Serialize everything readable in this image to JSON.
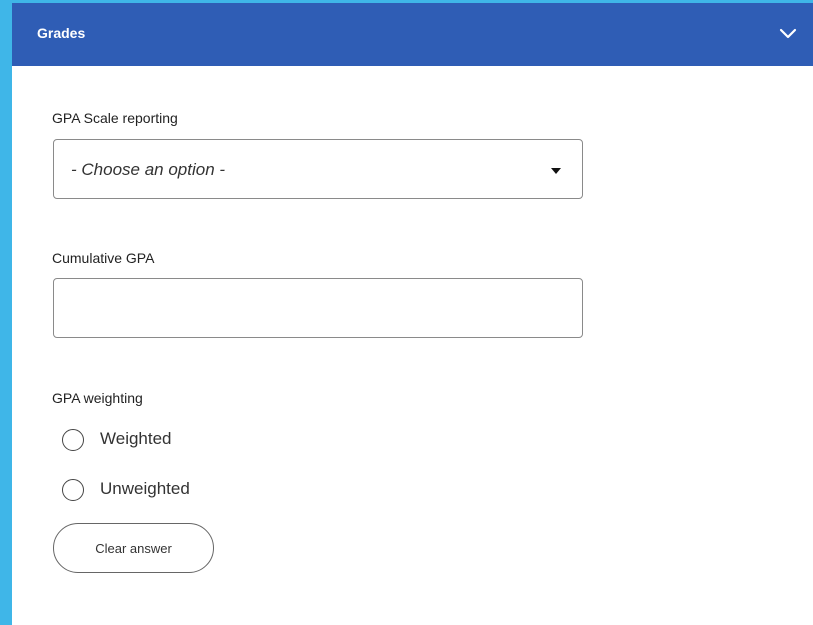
{
  "section": {
    "title": "Grades",
    "collapse_icon": "chevron-down-icon"
  },
  "gpa_scale": {
    "label": "GPA Scale reporting",
    "selected": "- Choose an option -",
    "icon": "caret-down-icon"
  },
  "cumulative_gpa": {
    "label": "Cumulative GPA",
    "value": ""
  },
  "gpa_weighting": {
    "label": "GPA weighting",
    "options": [
      {
        "label": "Weighted",
        "selected": false
      },
      {
        "label": "Unweighted",
        "selected": false
      }
    ],
    "clear_label": "Clear answer"
  },
  "colors": {
    "header_bg": "#2f5db5",
    "page_bg": "#3fb6e8"
  }
}
